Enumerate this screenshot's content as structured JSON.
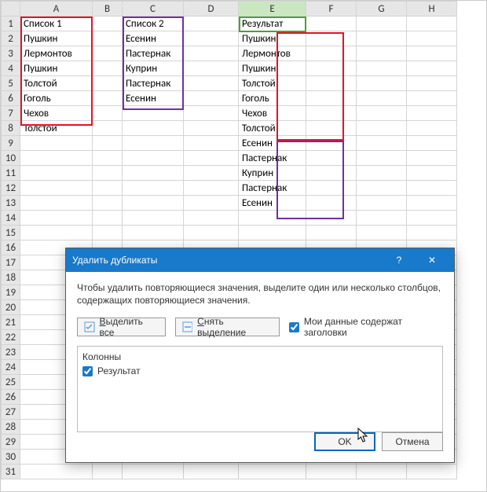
{
  "columns": [
    "A",
    "B",
    "C",
    "D",
    "E",
    "F",
    "G",
    "H"
  ],
  "rowCount": 31,
  "headers": {
    "A": "Список 1",
    "C": "Список 2",
    "E": "Результат"
  },
  "list1": [
    "Пушкин",
    "Лермонтов",
    "Пушкин",
    "Толстой",
    "Гоголь",
    "Чехов",
    "Толстой"
  ],
  "list2": [
    "Есенин",
    "Пастернак",
    "Куприн",
    "Пастернак",
    "Есенин"
  ],
  "result": [
    "Пушкин",
    "Лермонтов",
    "Пушкин",
    "Толстой",
    "Гоголь",
    "Чехов",
    "Толстой",
    "Есенин",
    "Пастернак",
    "Куприн",
    "Пастернак",
    "Есенин"
  ],
  "dialog": {
    "title": "Удалить дубликаты",
    "help": "?",
    "close": "✕",
    "message": "Чтобы удалить повторяющиеся значения, выделите один или несколько столбцов, содержащих повторяющиеся значения.",
    "select_all_full": "Выделить все",
    "select_all_prefix": "В",
    "select_all_rest": "ыделить все",
    "unselect_full": "Снять выделение",
    "unselect_prefix": "С",
    "unselect_rest": "нять выделение",
    "headers_checkbox": "Мои данные содержат заголовки",
    "columns_label": "Колонны",
    "column_item": "Результат",
    "ok": "OK",
    "cancel": "Отмена"
  }
}
